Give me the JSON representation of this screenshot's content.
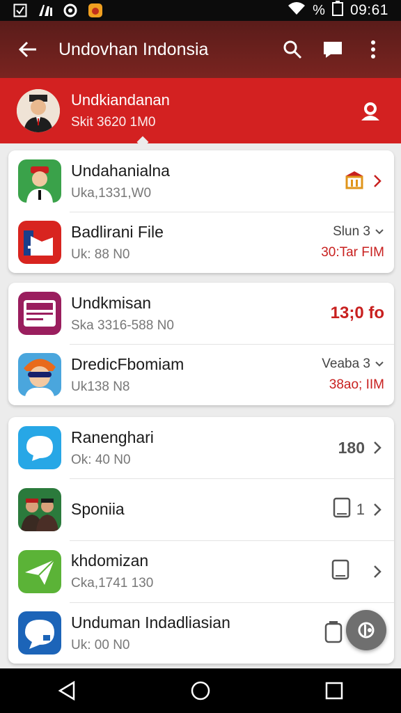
{
  "status": {
    "percent": "%",
    "time": "09:61"
  },
  "appbar": {
    "title": "Undovhan Indonsia"
  },
  "profile": {
    "name": "Undkiandanan",
    "sub": "Skit 3620 1M0"
  },
  "cards": [
    {
      "rows": [
        {
          "title": "Undahanialna",
          "sub": "Uka,1331,W0"
        },
        {
          "title": "Badlirani File",
          "sub": "Uk: 88 N0",
          "meta_top": "Slun 3",
          "meta_bottom": "30:Tar FIM"
        }
      ]
    },
    {
      "rows": [
        {
          "title": "Undkmisan",
          "sub": "Ska 3316-588 N0",
          "count": "13;0 fo"
        },
        {
          "title": "DredicFbomiam",
          "sub": "Uk138 N8",
          "meta_top": "Veaba 3",
          "meta_bottom": "38ao; IIM"
        }
      ]
    },
    {
      "rows": [
        {
          "title": "Ranenghari",
          "sub": "Ok: 40 N0",
          "count": "180"
        },
        {
          "title": "Sponiia",
          "sub": "",
          "count": "1"
        },
        {
          "title": "khdomizan",
          "sub": "Cka,1741 130"
        },
        {
          "title": "Unduman Indadliasian",
          "sub": "Uk: 00 N0"
        }
      ]
    }
  ],
  "colors": {
    "accent": "#d32121",
    "appbar": "#6b201d"
  }
}
